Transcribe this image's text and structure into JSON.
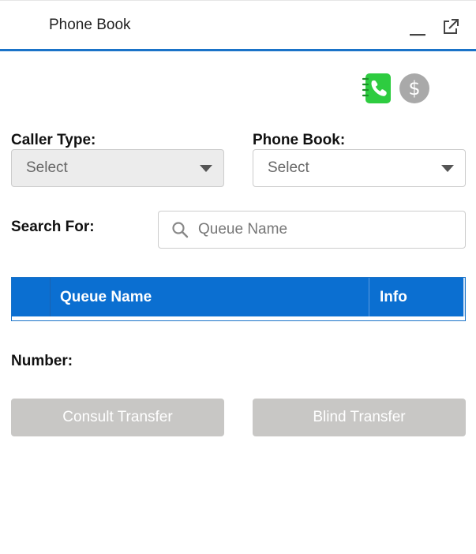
{
  "header": {
    "title": "Phone Book",
    "minimize_icon": "minimize-icon",
    "popout_icon": "external-link-icon"
  },
  "toolbar": {
    "phone_book_icon": "phone-book-icon",
    "phone_book_icon_color": "#2ecc40",
    "dollar_icon": "dollar-icon",
    "dollar_glyph": "$"
  },
  "form": {
    "caller_type_label": "Caller Type:",
    "caller_type_value": "Select",
    "phone_book_label": "Phone Book:",
    "phone_book_value": "Select",
    "search_for_label": "Search For:",
    "search_placeholder": "Queue Name"
  },
  "table": {
    "columns": [
      "Queue Name",
      "Info"
    ],
    "rows": []
  },
  "number_label": "Number:",
  "actions": {
    "consult_transfer": "Consult Transfer",
    "blind_transfer": "Blind Transfer"
  },
  "colors": {
    "accent": "#1a73c8",
    "table_header": "#0b6fd1",
    "disabled_button": "#c8c7c5"
  }
}
